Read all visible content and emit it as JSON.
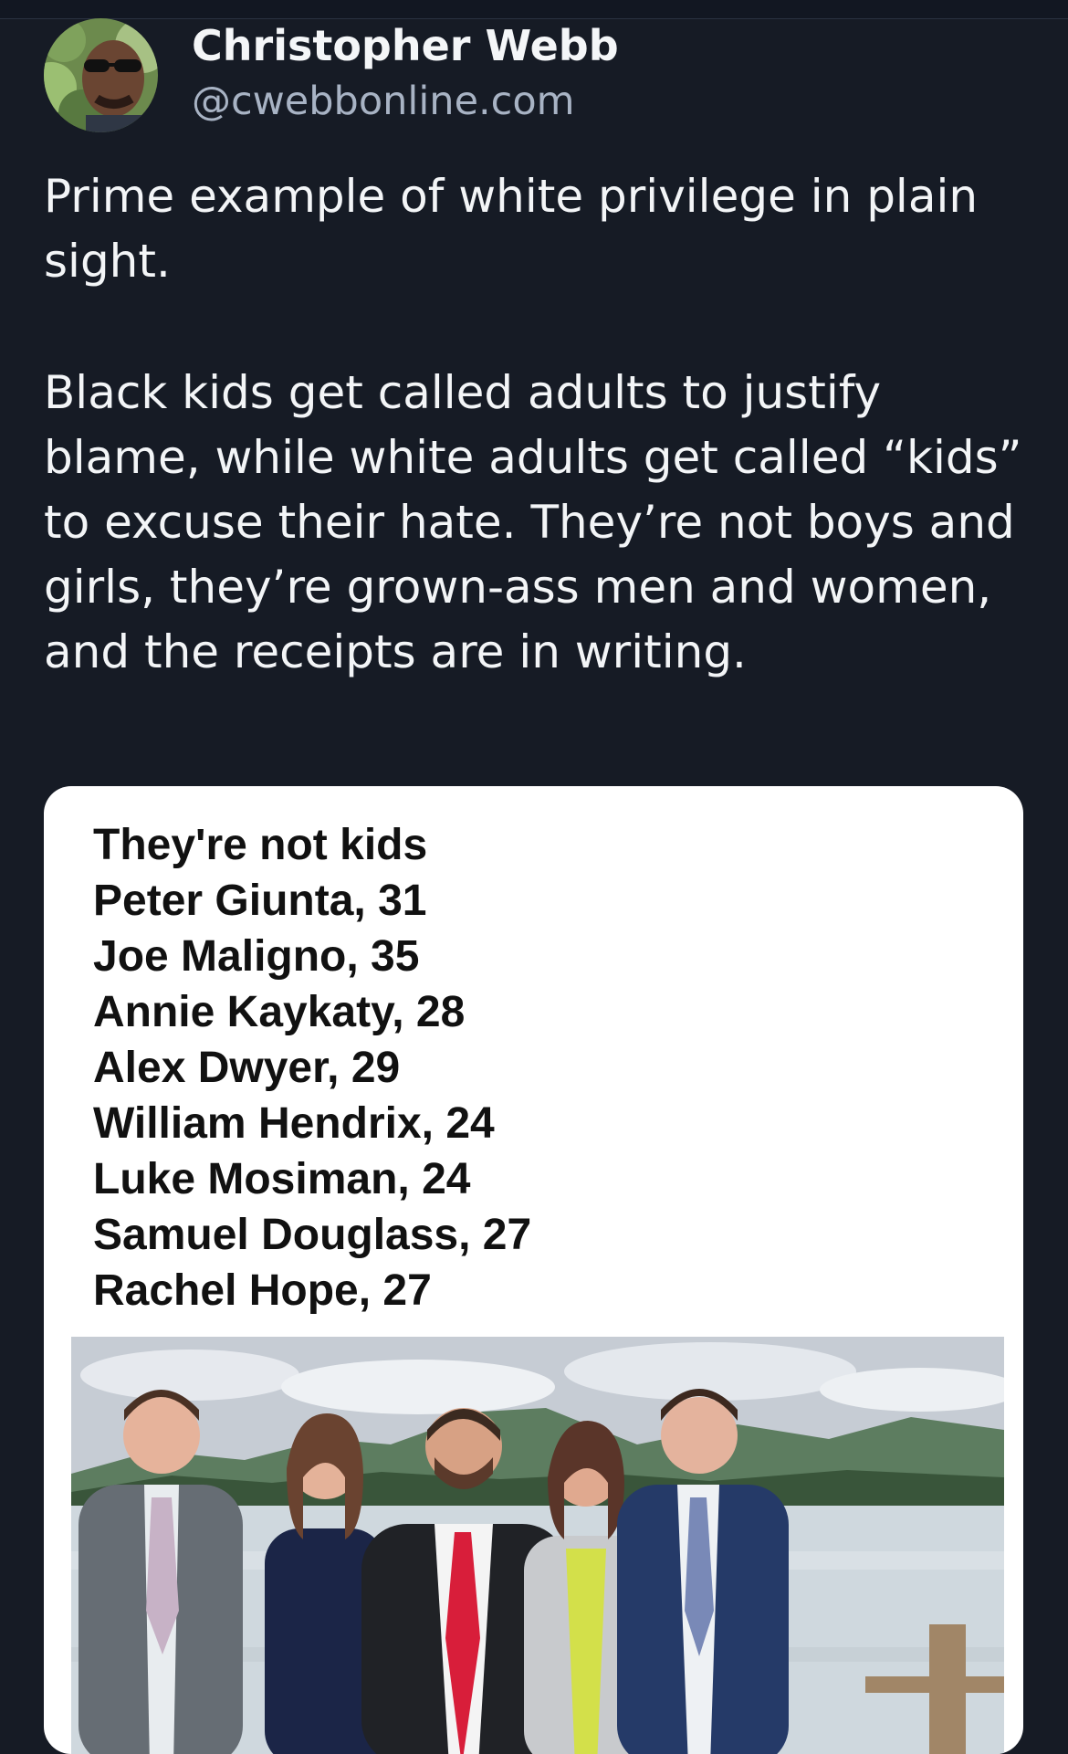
{
  "post": {
    "author": {
      "name": "Christopher Webb",
      "handle": "@cwebbonline.com"
    },
    "text": [
      "Prime example of white privilege in plain sight.",
      "Black kids get called adults to justify blame, while white adults get called “kids” to excuse their hate. They’re not boys and girls, they’re grown-ass men and women, and the receipts are in writing."
    ],
    "media": {
      "lines": [
        "They're not kids",
        "Peter Giunta, 31",
        "Joe Maligno, 35",
        "Annie Kaykaty, 28",
        "Alex Dwyer, 29",
        "William Hendrix, 24",
        "Luke Mosiman, 24",
        "Samuel Douglass, 27",
        "Rachel Hope, 27"
      ]
    }
  }
}
